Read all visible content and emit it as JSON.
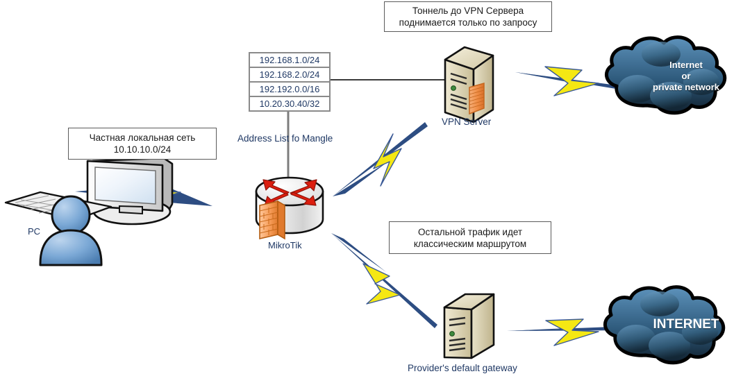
{
  "diagram": {
    "title": "MikroTik VPN policy routing network diagram",
    "colors": {
      "bolt_fill": "#f5e813",
      "bolt_stroke": "#3b5a96",
      "line": "#2d4d82",
      "cloud_dark": "#0f2231",
      "cloud_light": "#4a7ba4",
      "router_red": "#dc1e0f",
      "firewall_orange": "#f08a3c",
      "server_beige": "#d8cfae",
      "user_blue": "#5b8fc9",
      "text_navy": "#1f3864",
      "table_border": "#8a8a8a"
    },
    "notes": [
      {
        "id": "note-vpn",
        "lines": [
          "Тоннель до VPN Сервера",
          "поднимается только по запросу"
        ]
      },
      {
        "id": "note-lan",
        "lines": [
          "Частная локальная сеть",
          "10.10.10.0/24"
        ]
      },
      {
        "id": "note-rest",
        "lines": [
          "Остальной трафик идет",
          "классическим маршрутом"
        ]
      }
    ],
    "address_list": {
      "label": "Address List fo Mangle",
      "rows": [
        "192.168.1.0/24",
        "192.168.2.0/24",
        "192.192.0.0/16",
        "10.20.30.40/32"
      ]
    },
    "nodes": {
      "pc": {
        "label": "PC"
      },
      "router": {
        "label": "MikroTik"
      },
      "vpn_server": {
        "label": "VPN Server"
      },
      "gateway": {
        "label": "Provider's default gateway"
      },
      "cloud_top": {
        "lines": [
          "Internet",
          "or",
          "private network"
        ]
      },
      "cloud_bottom": {
        "lines": [
          "INTERNET"
        ]
      }
    }
  }
}
